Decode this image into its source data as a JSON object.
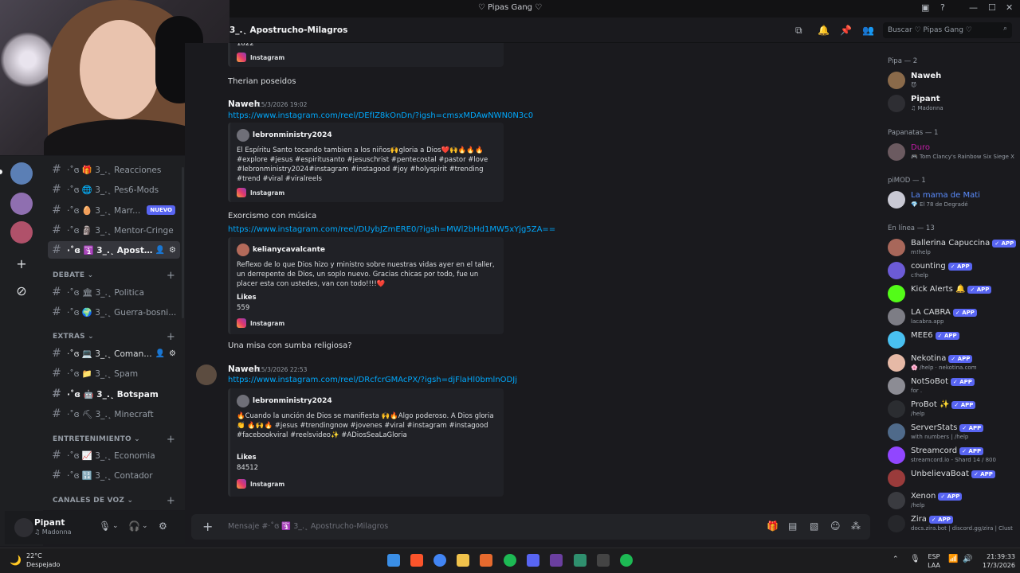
{
  "window": {
    "title": "♡ Pipas Gang ♡"
  },
  "header": {
    "channel_name": "3_.˛ Apostrucho-Milagros",
    "search_placeholder": "Buscar ♡ Pipas Gang ♡"
  },
  "channels": [
    {
      "name": "·˚ɞ 🎁 3_.˛ Reacciones"
    },
    {
      "name": "·˚ɞ 🌐 3_.˛ Pes6-Mods"
    },
    {
      "name": "·˚ɞ 🥚 3_.˛ Marr...",
      "badge": "NUEVO"
    },
    {
      "name": "·˚ɞ 🗿 3_.˛ Mentor-Cringe"
    },
    {
      "name": "·˚ɞ 🛐 3_.˛ Apostru...",
      "active": true
    },
    {
      "category": "DEBATE"
    },
    {
      "name": "·˚ɞ 🏛 3_.˛ Politica"
    },
    {
      "name": "·˚ɞ 🌍 3_.˛ Guerra-bosni..."
    },
    {
      "category": "EXTRAS"
    },
    {
      "name": "·˚ɞ 💻 3_.˛ Comand...",
      "hover": true
    },
    {
      "name": "·˚ɞ 📁 3_.˛ Spam"
    },
    {
      "name": "·˚ɞ 🤖 3_.˛ Botspam",
      "bold": true
    },
    {
      "name": "·˚ɞ ⛏ 3_.˛ Minecraft"
    },
    {
      "category": "ENTRETENIMIENTO"
    },
    {
      "name": "·˚ɞ 📈 3_.˛ Economia"
    },
    {
      "name": "·˚ɞ 🔢 3_.˛ Contador"
    },
    {
      "category": "CANALES DE VOZ"
    }
  ],
  "user": {
    "name": "Pipant",
    "status": "Madonna"
  },
  "messages": {
    "top_embed_value": "1822",
    "instagram": "Instagram",
    "msg1_text": "Therian poseidos",
    "msg2": {
      "author": "Naweh",
      "date": "15/3/2026 19:02",
      "link": "https://www.instagram.com/reel/DEfIZ8kOnDn/?igsh=cmsxMDAwNWN0N3c0",
      "embed_author": "lebronministry2024",
      "embed_desc": "El Espíritu Santo tocando tambien a los niños🙌gloria a Dios❤️🙌🔥🔥🔥 #explore #jesus #espiritusanto #jesuschrist #pentecostal #pastor #love #lebronministry2024#instagram #instagood #joy #holyspirit #trending #trend #viral #viralreels"
    },
    "msg3": {
      "text": "Exorcismo con música",
      "link": "https://www.instagram.com/reel/DUybJZmERE0/?igsh=MWl2bHd1MW5xYjg5ZA==",
      "embed_author": "kelianycavalcante",
      "embed_desc": "Reflexo de lo que Dios hizo y ministro sobre nuestras vidas ayer en el taller, un derrepente de Dios, un soplo nuevo. Gracias chicas por todo, fue un placer esta con ustedes, van con todo!!!!❤️",
      "likes_label": "Likes",
      "likes_value": "559"
    },
    "msg4_text": "Una misa con sumba religiosa?",
    "msg5": {
      "author": "Naweh",
      "date": "15/3/2026 22:53",
      "link": "https://www.instagram.com/reel/DRcfcrGMAcPX/?igsh=djFlaHl0bmlnODJj",
      "embed_author": "lebronministry2024",
      "embed_desc": "🔥Cuando la unción de Dios se manifiesta 🙌🔥Algo poderoso. A Dios gloria 👏 🔥🙌🔥 #jesus #trendingnow #jovenes #viral #instagram #instagood #facebookviral #reelsvideo✨ #ADiosSeaLaGloria",
      "likes_label": "Likes",
      "likes_value": "84512"
    }
  },
  "composer": {
    "placeholder": "Mensaje #·˚ɞ 🛐 3_.˛ Apostrucho-Milagros"
  },
  "members": {
    "cat1": "Pipa — 2",
    "m1": {
      "name": "Naweh",
      "status": "😈"
    },
    "m2": {
      "name": "Pipant",
      "status": "♫ Madonna"
    },
    "cat2": "Papanatas — 1",
    "m3": {
      "name": "Duro",
      "status": "🎮 Tom Clancy's Rainbow Six Siege X"
    },
    "cat3": "piMOD — 1",
    "m4": {
      "name": "La mama de Mati",
      "status": "💎 El 78 de Degradé"
    },
    "cat4": "En línea — 13",
    "app_label": "✓ APP",
    "bots": [
      {
        "name": "Ballerina Capuccina",
        "status": "m!help"
      },
      {
        "name": "counting",
        "status": "c!help"
      },
      {
        "name": "Kick Alerts 🔔",
        "status": ""
      },
      {
        "name": "LA CABRA",
        "status": "lacabra.app"
      },
      {
        "name": "MEE6",
        "status": ""
      },
      {
        "name": "Nekotina",
        "status": "🌸 /help · nekotina.com"
      },
      {
        "name": "NotSoBot",
        "status": "for ."
      },
      {
        "name": "ProBot ✨",
        "status": "/help"
      },
      {
        "name": "ServerStats",
        "status": "with numbers | /help"
      },
      {
        "name": "Streamcord",
        "status": "streamcord.io - Shard 14 / 800"
      },
      {
        "name": "UnbelievaBoat",
        "status": ""
      },
      {
        "name": "Xenon",
        "status": "/help"
      },
      {
        "name": "Zira",
        "status": "docs.zira.bot | discord.gg/zira | Clust"
      }
    ]
  },
  "taskbar": {
    "weather_temp": "22°C",
    "weather_desc": "Despejado",
    "lang1": "ESP",
    "lang2": "LAA",
    "time": "21:39:33",
    "date": "17/3/2026"
  }
}
